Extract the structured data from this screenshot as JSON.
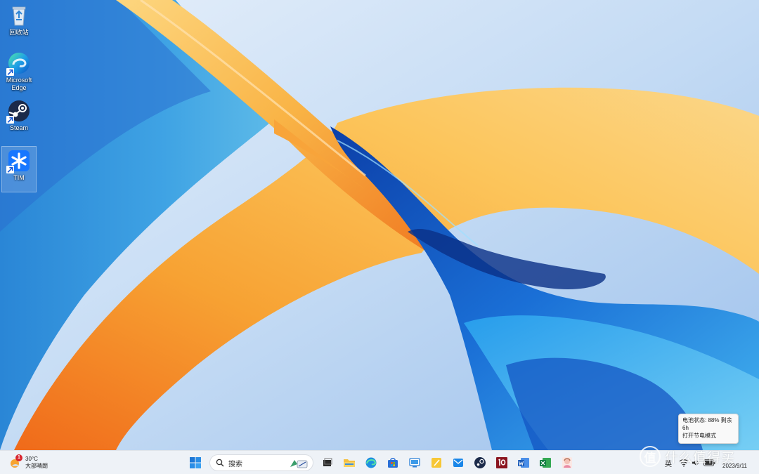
{
  "desktop": {
    "icons": [
      {
        "label": "回收站",
        "icon": "recycle-bin-icon"
      },
      {
        "label": "Microsoft Edge",
        "icon": "edge-icon"
      },
      {
        "label": "Steam",
        "icon": "steam-icon"
      },
      {
        "label": "TIM",
        "icon": "tim-icon"
      }
    ]
  },
  "tooltip": {
    "line1": "电池状态: 88% 剩余",
    "line2": "6h",
    "line3": "打开节电模式"
  },
  "taskbar": {
    "weather": {
      "temp": "30°C",
      "condition": "大部晴朗",
      "badge": "1"
    },
    "search": {
      "placeholder": "搜索"
    },
    "apps": [
      "start-icon",
      "task-view-icon",
      "file-explorer-icon",
      "edge-icon",
      "store-icon",
      "remote-desktop-icon",
      "sticky-notes-icon",
      "mail-icon",
      "steam-icon",
      "app-10-icon",
      "word-icon",
      "excel-icon",
      "anime-app-icon"
    ],
    "tray": {
      "ime": "英",
      "date": "2023/9/11"
    }
  },
  "watermark": {
    "text": "什么值得买",
    "logo": "值"
  },
  "colors": {
    "taskbar_bg": "#eef2f7",
    "wallpaper_sky": "#bcd6f2",
    "wallpaper_orange": "#f59a2a",
    "wallpaper_blue": "#1e6fd0"
  }
}
